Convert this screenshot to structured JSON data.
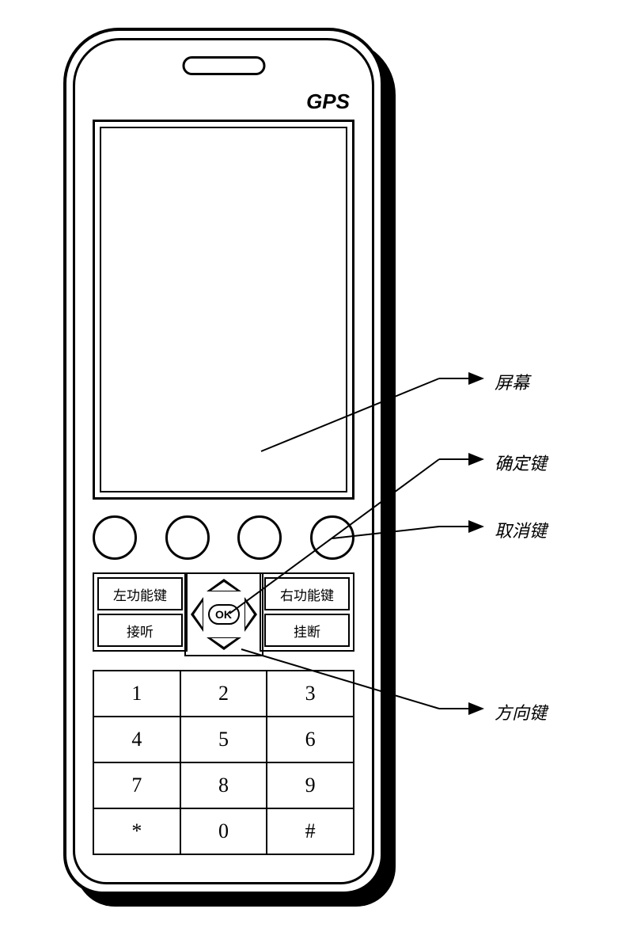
{
  "gps": "GPS",
  "soft_keys": {
    "left_top": "左功能键",
    "left_bottom": "接听",
    "right_top": "右功能键",
    "right_bottom": "挂断"
  },
  "ok": "OK",
  "keypad": [
    [
      "1",
      "2",
      "3"
    ],
    [
      "4",
      "5",
      "6"
    ],
    [
      "7",
      "8",
      "9"
    ],
    [
      "*",
      "0",
      "#"
    ]
  ],
  "callouts": {
    "screen": "屏幕",
    "ok_key": "确定键",
    "cancel_key": "取消键",
    "direction_key": "方向键"
  }
}
